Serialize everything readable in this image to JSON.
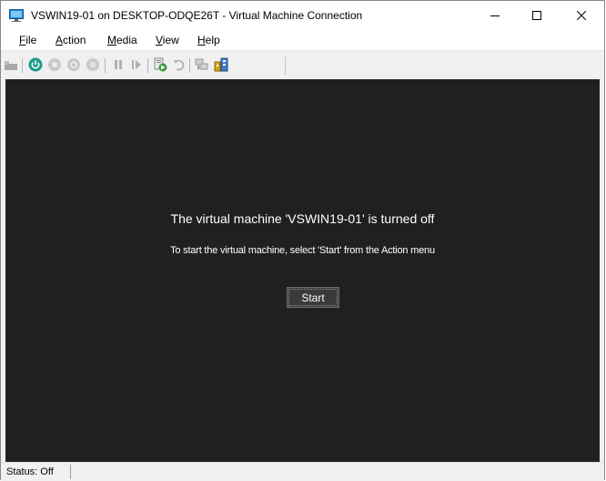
{
  "window": {
    "title": "VSWIN19-01 on DESKTOP-ODQE26T - Virtual Machine Connection",
    "controls": [
      "minimize",
      "maximize",
      "close"
    ]
  },
  "menu": {
    "file": "File",
    "action": "Action",
    "media": "Media",
    "view": "View",
    "help": "Help"
  },
  "toolbar": {
    "buttons": [
      {
        "icon": "ctrl-alt-del-icon",
        "enabled": false
      },
      {
        "icon": "start-icon",
        "enabled": true
      },
      {
        "icon": "turn-off-icon",
        "enabled": false
      },
      {
        "icon": "shut-down-icon",
        "enabled": false
      },
      {
        "icon": "save-icon",
        "enabled": false
      },
      {
        "icon": "pause-icon",
        "enabled": false
      },
      {
        "icon": "resume-icon",
        "enabled": false
      },
      {
        "icon": "checkpoint-icon",
        "enabled": true
      },
      {
        "icon": "revert-icon",
        "enabled": false
      },
      {
        "icon": "enhanced-session-icon",
        "enabled": false
      },
      {
        "icon": "share-icon",
        "enabled": true
      }
    ],
    "colors": {
      "start": "#1a9b8b",
      "checkpoint": "#3c9a3c",
      "share": "#d8a21c"
    }
  },
  "vm": {
    "message": "The virtual machine 'VSWIN19-01' is turned off",
    "instruction": "To start the virtual machine, select 'Start' from the Action menu",
    "start_label": "Start",
    "background": "#202020"
  },
  "status": {
    "text": "Status: Off"
  }
}
